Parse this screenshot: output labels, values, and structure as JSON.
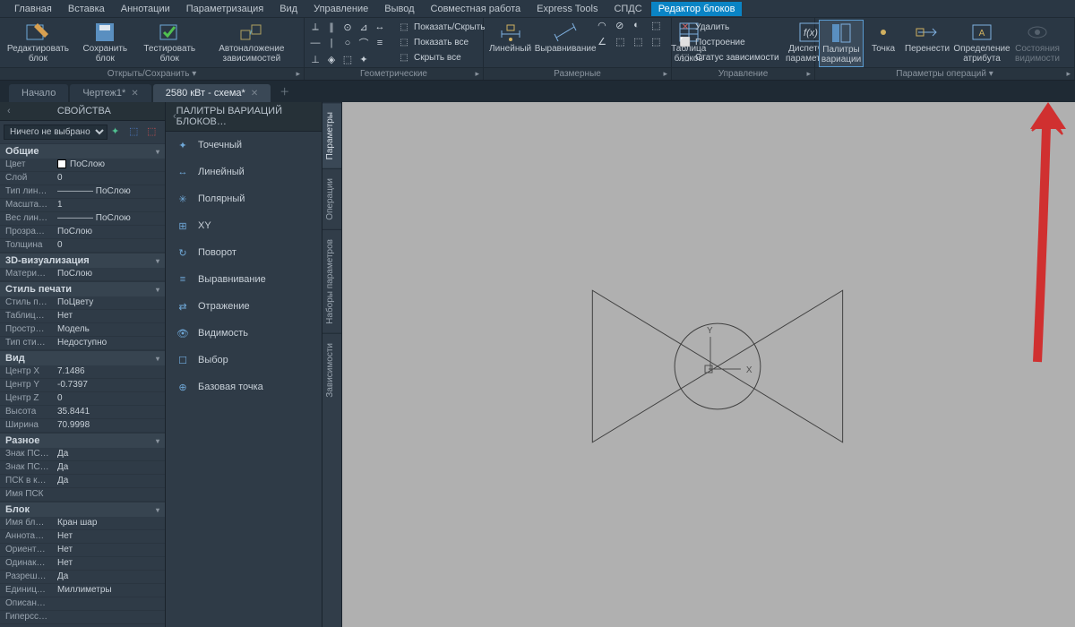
{
  "menubar": [
    "Главная",
    "Вставка",
    "Аннотации",
    "Параметризация",
    "Вид",
    "Управление",
    "Вывод",
    "Совместная работа",
    "Express Tools",
    "СПДС",
    "Редактор блоков"
  ],
  "menubar_active": 10,
  "ribbon": {
    "g0": {
      "label": "Открыть/Сохранить ▾",
      "btns": [
        "Редактировать блок",
        "Сохранить блок",
        "Тестировать блок",
        "Автоналожение зависимостей"
      ]
    },
    "g1": {
      "label": "Геометрические",
      "rows": [
        "Показать/Скрыть",
        "Показать все",
        "Скрыть все"
      ]
    },
    "g2": {
      "label": "Размерные",
      "btns": [
        "Линейный",
        "Выравнивание",
        "Таблица блоков"
      ]
    },
    "g3": {
      "label": "Управление",
      "rows": [
        "Удалить",
        "Построение",
        "Статус зависимости"
      ],
      "btn": "Диспетчер параметров"
    },
    "g4": {
      "label": "Параметры операций ▾",
      "btns": [
        "Палитры вариации",
        "Точка",
        "Перенести",
        "Определение атрибута",
        "Состояния видимости"
      ]
    }
  },
  "tabs": [
    {
      "label": "Начало",
      "closable": false
    },
    {
      "label": "Чертеж1*",
      "closable": true
    },
    {
      "label": "2580 кВт - схема*",
      "closable": true,
      "active": true
    }
  ],
  "props": {
    "title": "СВОЙСТВА",
    "selection": "Ничего не выбрано",
    "sections": [
      {
        "name": "Общие",
        "rows": [
          [
            "Цвет",
            "ПоСлою",
            "swatch"
          ],
          [
            "Слой",
            "0"
          ],
          [
            "Тип лин…",
            "———— ПоСлою"
          ],
          [
            "Масшта…",
            "1"
          ],
          [
            "Вес лин…",
            "———— ПоСлою"
          ],
          [
            "Прозра…",
            "ПоСлою"
          ],
          [
            "Толщина",
            "0"
          ]
        ]
      },
      {
        "name": "3D-визуализация",
        "rows": [
          [
            "Матери…",
            "ПоСлою"
          ]
        ]
      },
      {
        "name": "Стиль печати",
        "rows": [
          [
            "Стиль п…",
            "ПоЦвету"
          ],
          [
            "Таблиц…",
            "Нет"
          ],
          [
            "Простр…",
            "Модель"
          ],
          [
            "Тип сти…",
            "Недоступно"
          ]
        ]
      },
      {
        "name": "Вид",
        "rows": [
          [
            "Центр X",
            "7.1486"
          ],
          [
            "Центр Y",
            "-0.7397"
          ],
          [
            "Центр Z",
            "0"
          ],
          [
            "Высота",
            "35.8441"
          ],
          [
            "Ширина",
            "70.9998"
          ]
        ]
      },
      {
        "name": "Разное",
        "rows": [
          [
            "Знак ПС…",
            "Да"
          ],
          [
            "Знак ПС…",
            "Да"
          ],
          [
            "ПСК в к…",
            "Да"
          ],
          [
            "Имя ПСК",
            ""
          ]
        ]
      },
      {
        "name": "Блок",
        "rows": [
          [
            "Имя бл…",
            "Кран шар"
          ],
          [
            "Аннота…",
            "Нет"
          ],
          [
            "Ориент…",
            "Нет"
          ],
          [
            "Одинак…",
            "Нет"
          ],
          [
            "Разреш…",
            "Да"
          ],
          [
            "Единиц…",
            "Миллиметры"
          ],
          [
            "Описан…",
            ""
          ],
          [
            "Гиперсс…",
            ""
          ]
        ]
      }
    ]
  },
  "palette": {
    "title": "ПАЛИТРЫ ВАРИАЦИЙ БЛОКОВ…",
    "items": [
      "Точечный",
      "Линейный",
      "Полярный",
      "XY",
      "Поворот",
      "Выравнивание",
      "Отражение",
      "Видимость",
      "Выбор",
      "Базовая точка"
    ]
  },
  "vtabs": [
    "Параметры",
    "Операции",
    "Наборы параметров",
    "Зависимости"
  ],
  "vtab_active": 0,
  "canvas": {
    "ucs": {
      "x_label": "X",
      "y_label": "Y"
    }
  }
}
